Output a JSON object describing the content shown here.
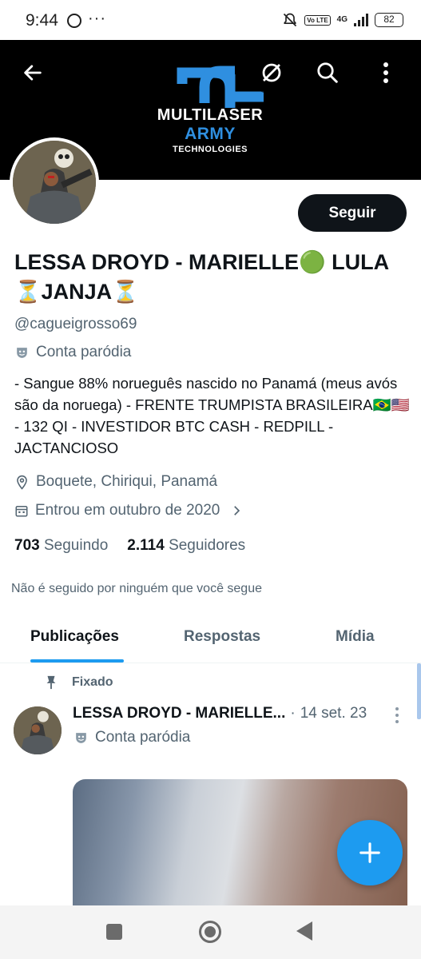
{
  "status_bar": {
    "time": "9:44",
    "more_indicator": "···",
    "volte": "Vo LTE",
    "network": "4G",
    "battery": "82"
  },
  "banner": {
    "logo_line1": "MULTILASER",
    "logo_line2": "ARMY",
    "logo_line3": "TECHNOLOGIES",
    "logo_color": "#2f8fe0",
    "icons": [
      "back-arrow-icon",
      "explore-off-icon",
      "search-icon",
      "more-vertical-icon"
    ]
  },
  "profile": {
    "follow_label": "Seguir",
    "name": "LESSA DROYD - MARIELLE🟢 LULA⏳JANJA⏳",
    "handle": "@cagueigrosso69",
    "parody_label": "Conta paródia",
    "bio": "- Sangue 88% norueguês nascido no Panamá (meus avós são da noruega) - FRENTE TRUMPISTA BRASILEIRA🇧🇷🇺🇸 - 132 QI - INVESTIDOR BTC CASH - REDPILL - JACTANCIOSO",
    "location": "Boquete, Chiriqui, Panamá",
    "joined": "Entrou em outubro de 2020",
    "following_count": "703",
    "following_label": "Seguindo",
    "followers_count": "2.114",
    "followers_label": "Seguidores",
    "not_followed_note": "Não é seguido por ninguém que você segue"
  },
  "tabs": [
    {
      "label": "Publicações",
      "active": true
    },
    {
      "label": "Respostas",
      "active": false
    },
    {
      "label": "Mídia",
      "active": false
    }
  ],
  "pinned_post": {
    "pinned_label": "Fixado",
    "author": "LESSA DROYD - MARIELLE...",
    "separator": "·",
    "date": "14 set. 23",
    "parody_label": "Conta paródia"
  },
  "colors": {
    "accent": "#1d9bf0",
    "text": "#0f1419",
    "secondary_text": "#536471"
  }
}
